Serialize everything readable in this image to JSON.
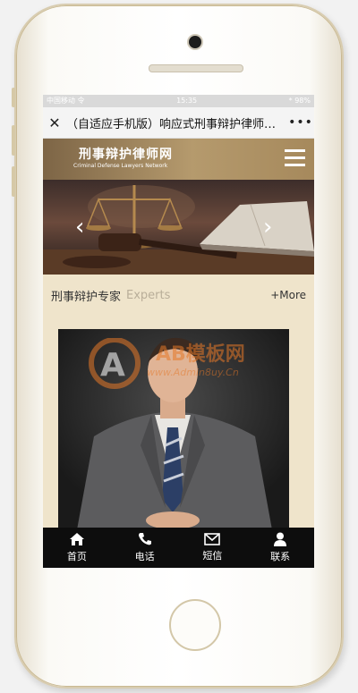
{
  "status_bar": {
    "carrier": "中国移动 令",
    "time": "15:35",
    "battery": "* 98%"
  },
  "browser": {
    "title": "（自适应手机版）响应式刑事辩护律师网站…",
    "close_icon": "close-icon",
    "more_icon": "more-icon"
  },
  "header": {
    "site_title": "刑事辩护律师网",
    "site_subtitle": "Criminal Defense Lawyers Network",
    "menu_icon": "hamburger-icon"
  },
  "banner": {
    "prev_icon": "chevron-left-icon",
    "next_icon": "chevron-right-icon",
    "subject": "gavel-scales-book"
  },
  "section": {
    "title_cn": "刑事辩护专家",
    "title_en": "Experts",
    "more": "+More"
  },
  "watermark": {
    "text": "AB模板网",
    "url": "www.Admin8uy.Cn"
  },
  "tabs": [
    {
      "label": "首页",
      "icon": "home-icon"
    },
    {
      "label": "电话",
      "icon": "phone-icon"
    },
    {
      "label": "短信",
      "icon": "mail-icon"
    },
    {
      "label": "联系",
      "icon": "user-icon"
    }
  ],
  "colors": {
    "header_gold": "#a6895c",
    "page_bg": "#efe4cb",
    "tabbar": "#0d0d0d"
  }
}
